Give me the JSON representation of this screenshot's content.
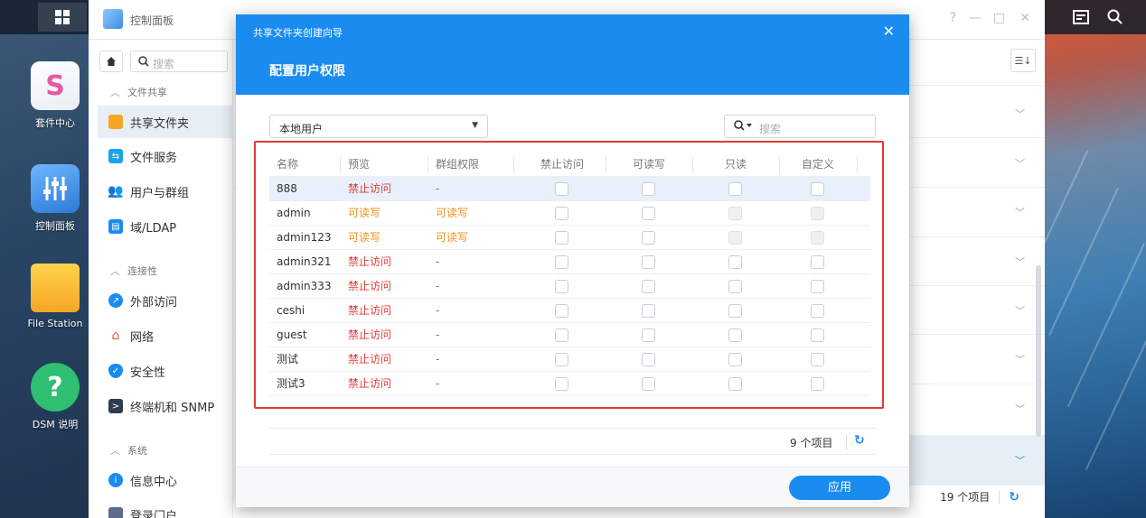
{
  "desktop": {
    "icons": [
      {
        "label": "套件中心",
        "icon": "package-center-icon"
      },
      {
        "label": "控制面板",
        "icon": "control-panel-icon"
      },
      {
        "label": "File Station",
        "icon": "folder-icon"
      },
      {
        "label": "DSM 说明",
        "icon": "help-icon"
      }
    ]
  },
  "control_panel": {
    "title": "控制面板",
    "search_placeholder": "搜索",
    "groups": {
      "file_sharing": "文件共享",
      "connectivity": "连接性",
      "system": "系统"
    },
    "items": {
      "shared_folder": "共享文件夹",
      "file_services": "文件服务",
      "user_group": "用户与群组",
      "domain_ldap": "域/LDAP",
      "external_access": "外部访问",
      "network": "网络",
      "security": "安全性",
      "terminal_snmp": "终端机和 SNMP",
      "info_center": "信息中心",
      "login_portal": "登录门户"
    },
    "footer_count": "19 个项目",
    "window_controls": {
      "help": "?",
      "minimize": "—",
      "maximize": "□",
      "close": "✕"
    }
  },
  "wizard": {
    "title": "共享文件夹创建向导",
    "step_title": "配置用户权限",
    "close_glyph": "✕",
    "user_type": "本地用户",
    "search_placeholder": "搜索",
    "columns": {
      "name": "名称",
      "preview": "预览",
      "group_perm": "群组权限",
      "deny": "禁止访问",
      "read_write": "可读写",
      "read_only": "只读",
      "custom": "自定义"
    },
    "rows": [
      {
        "name": "888",
        "preview": "禁止访问",
        "group": "-"
      },
      {
        "name": "admin",
        "preview": "可读写",
        "group": "可读写"
      },
      {
        "name": "admin123",
        "preview": "可读写",
        "group": "可读写"
      },
      {
        "name": "admin321",
        "preview": "禁止访问",
        "group": "-"
      },
      {
        "name": "admin333",
        "preview": "禁止访问",
        "group": "-"
      },
      {
        "name": "ceshi",
        "preview": "禁止访问",
        "group": "-"
      },
      {
        "name": "guest",
        "preview": "禁止访问",
        "group": "-"
      },
      {
        "name": "测试",
        "preview": "禁止访问",
        "group": "-"
      },
      {
        "name": "测试3",
        "preview": "禁止访问",
        "group": "-"
      }
    ],
    "item_count": "9 个项目",
    "apply_label": "应用"
  },
  "colors": {
    "accent": "#1a8cf0",
    "deny": "#e53935",
    "read_write": "#f0911c",
    "highlight_box": "#e53935"
  }
}
